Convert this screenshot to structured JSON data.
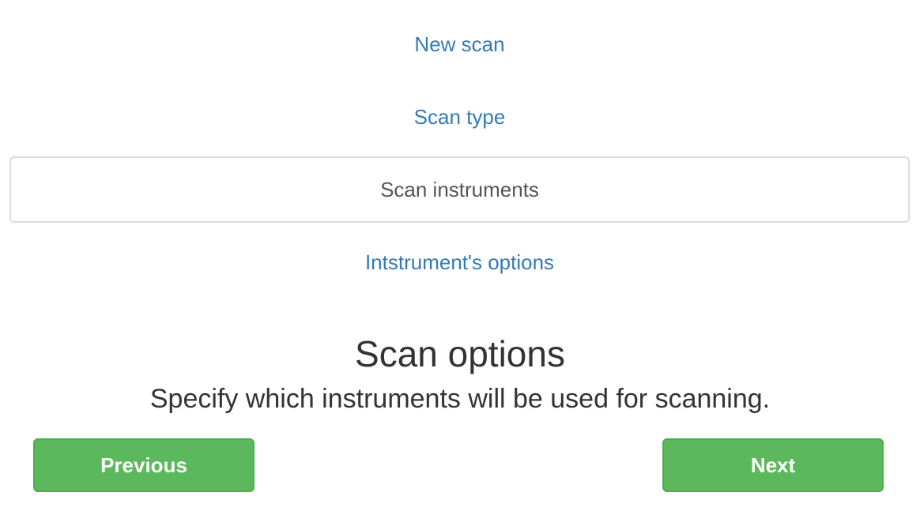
{
  "wizard": {
    "steps": [
      {
        "label": "New scan",
        "state": "link"
      },
      {
        "label": "Scan type",
        "state": "link"
      },
      {
        "label": "Scan instruments",
        "state": "active"
      },
      {
        "label": "Intstrument's options",
        "state": "link"
      }
    ]
  },
  "main": {
    "title": "Scan options",
    "description": "Specify which instruments will be used for scanning."
  },
  "buttons": {
    "previous_label": "Previous",
    "next_label": "Next"
  },
  "colors": {
    "link": "#337ab7",
    "active_border": "#dddddd",
    "button_green": "#5cb85c",
    "button_border": "#4cae4c"
  }
}
